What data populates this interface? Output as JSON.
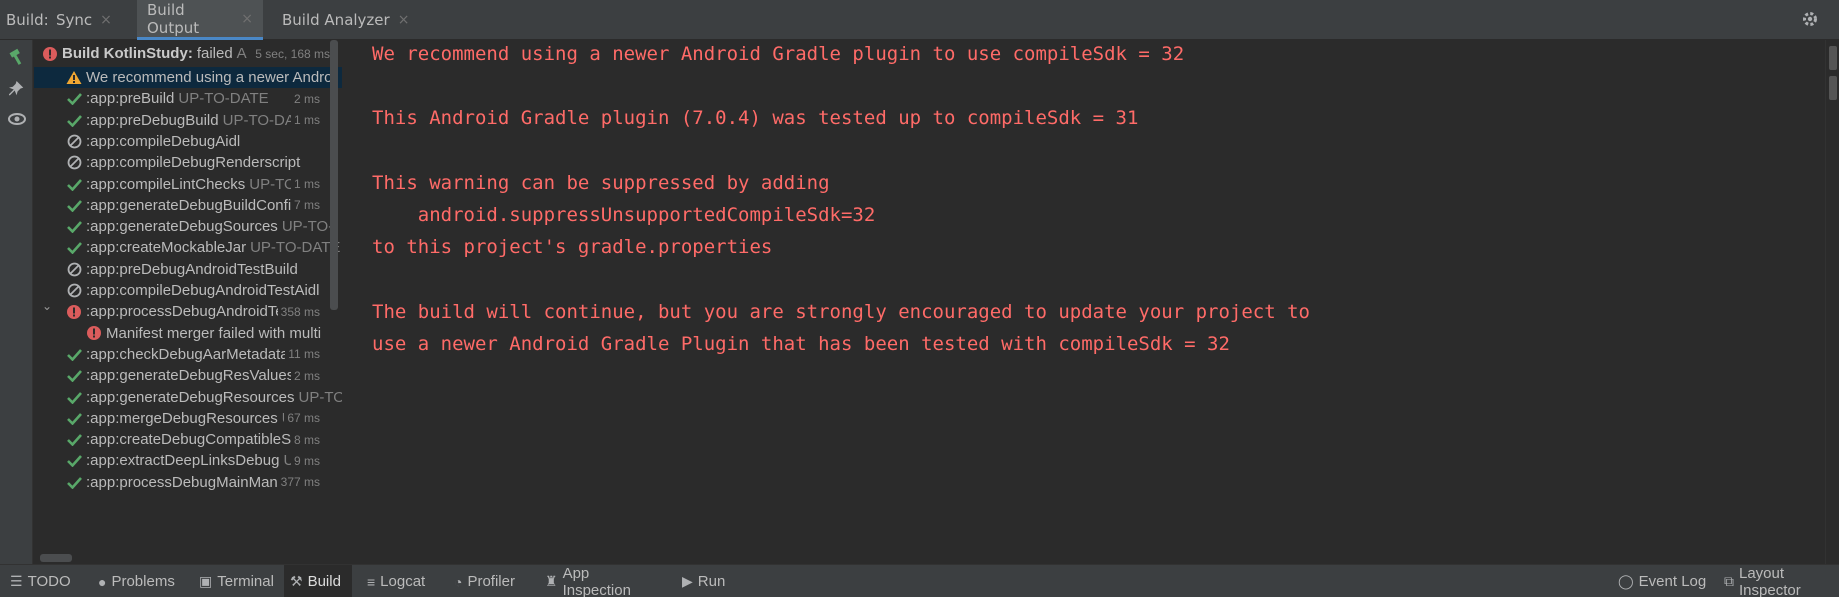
{
  "header": {
    "label": "Build:",
    "tabs": [
      {
        "label": "Sync",
        "closable": true,
        "active": false
      },
      {
        "label": "Build Output",
        "closable": true,
        "active": true
      },
      {
        "label": "Build Analyzer",
        "closable": true,
        "active": false
      }
    ],
    "close_glyph": "×"
  },
  "tree": {
    "root": {
      "label": "Build KotlinStudy:",
      "status": "failed",
      "extra": "A",
      "time": "5 sec, 168 ms"
    },
    "rows": [
      {
        "icon": "warning-icon",
        "label": "We recommend using a newer Andro",
        "status": "",
        "time": ""
      },
      {
        "icon": "check-icon",
        "label": ":app:preBuild",
        "status": "UP-TO-DATE",
        "time": "2 ms"
      },
      {
        "icon": "check-icon",
        "label": ":app:preDebugBuild",
        "status": "UP-TO-DA",
        "time": "1 ms"
      },
      {
        "icon": "skipped-icon",
        "label": ":app:compileDebugAidl",
        "status": "",
        "time": ""
      },
      {
        "icon": "skipped-icon",
        "label": ":app:compileDebugRenderscript",
        "status": "",
        "time": ""
      },
      {
        "icon": "check-icon",
        "label": ":app:compileLintChecks",
        "status": "UP-TO-",
        "time": "1 ms"
      },
      {
        "icon": "check-icon",
        "label": ":app:generateDebugBuildConfi",
        "status": "",
        "time": "7 ms"
      },
      {
        "icon": "check-icon",
        "label": ":app:generateDebugSources",
        "status": "UP-TO-I",
        "time": ""
      },
      {
        "icon": "check-icon",
        "label": ":app:createMockableJar",
        "status": "UP-TO-DATE",
        "time": ""
      },
      {
        "icon": "skipped-icon",
        "label": ":app:preDebugAndroidTestBuild",
        "status": "",
        "time": ""
      },
      {
        "icon": "skipped-icon",
        "label": ":app:compileDebugAndroidTestAidl",
        "status": "",
        "time": ""
      },
      {
        "icon": "error-icon",
        "label": ":app:processDebugAndroidTe",
        "status": "",
        "time": "358 ms",
        "expanded": true
      },
      {
        "icon": "error-icon",
        "label": "Manifest merger failed with multi",
        "status": "",
        "time": "",
        "indent": 1
      },
      {
        "icon": "check-icon",
        "label": ":app:checkDebugAarMetadata",
        "status": "",
        "time": "11 ms"
      },
      {
        "icon": "check-icon",
        "label": ":app:generateDebugResValues",
        "status": "",
        "time": "2 ms"
      },
      {
        "icon": "check-icon",
        "label": ":app:generateDebugResources",
        "status": "UP-TO",
        "time": ""
      },
      {
        "icon": "check-icon",
        "label": ":app:mergeDebugResources",
        "status": "U",
        "time": "67 ms"
      },
      {
        "icon": "check-icon",
        "label": ":app:createDebugCompatibleSc",
        "status": "",
        "time": "8 ms"
      },
      {
        "icon": "check-icon",
        "label": ":app:extractDeepLinksDebug",
        "status": "UI",
        "time": "9 ms"
      },
      {
        "icon": "check-icon",
        "label": ":app:processDebugMainMani",
        "status": "",
        "time": "377 ms"
      }
    ]
  },
  "console": {
    "lines": [
      "We recommend using a newer Android Gradle plugin to use compileSdk = 32",
      "",
      "This Android Gradle plugin (7.0.4) was tested up to compileSdk = 31",
      "",
      "This warning can be suppressed by adding",
      "    android.suppressUnsupportedCompileSdk=32",
      "to this project's gradle.properties",
      "",
      "The build will continue, but you are strongly encouraged to update your project to",
      "use a newer Android Gradle Plugin that has been tested with compileSdk = 32"
    ]
  },
  "bottom_bar": {
    "left": [
      {
        "label": "TODO",
        "icon": "list-icon",
        "active": false
      },
      {
        "label": "Problems",
        "icon": "problems-icon",
        "active": false
      },
      {
        "label": "Terminal",
        "icon": "terminal-icon",
        "active": false
      },
      {
        "label": "Build",
        "icon": "hammer-icon",
        "active": true
      },
      {
        "label": "Logcat",
        "icon": "logcat-icon",
        "active": false
      },
      {
        "label": "Profiler",
        "icon": "profiler-icon",
        "active": false
      },
      {
        "label": "App Inspection",
        "icon": "inspection-icon",
        "active": false
      },
      {
        "label": "Run",
        "icon": "run-icon",
        "active": false
      }
    ],
    "right": [
      {
        "label": "Event Log",
        "icon": "event-log-icon"
      },
      {
        "label": "Layout Inspector",
        "icon": "layout-inspector-icon"
      }
    ]
  },
  "colors": {
    "console_error": "#ff6b68",
    "success": "#59a869",
    "error": "#db5c5c",
    "warning": "#f0a732",
    "selection": "#0d293e"
  }
}
